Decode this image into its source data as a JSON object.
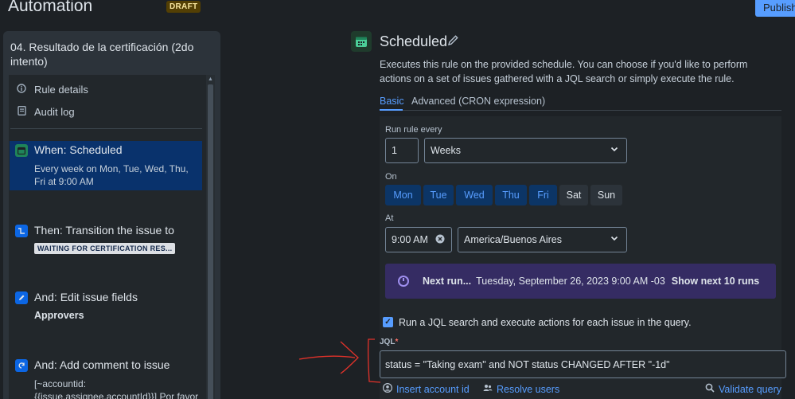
{
  "header": {
    "title": "Automation",
    "draft_badge": "DRAFT",
    "publish_label": "Publish"
  },
  "sidebar": {
    "rule_name": "04. Resultado de la certificación (2do intento)",
    "links": [
      {
        "label": "Rule details",
        "icon": "info-icon"
      },
      {
        "label": "Audit log",
        "icon": "document-icon"
      }
    ],
    "steps": [
      {
        "title": "When: Scheduled",
        "subtitle": "Every week on Mon, Tue, Wed, Thu, Fri at 9:00 AM",
        "icon": "calendar-icon",
        "active": true
      },
      {
        "title": "Then: Transition the issue to",
        "badge": "WAITING FOR CERTIFICATION RES...",
        "icon": "transition-icon"
      },
      {
        "title": "And: Edit issue fields",
        "detail": "Approvers",
        "icon": "pencil-icon"
      },
      {
        "title": "And: Add comment to issue",
        "detail_lines": [
          "[~accountid:",
          "{{issue.assignee.accountId}}] Por favor"
        ],
        "icon": "comment-icon"
      }
    ]
  },
  "main": {
    "title": "Scheduled",
    "description": "Executes this rule on the provided schedule. You can choose if you'd like to perform actions on a set of issues gathered with a JQL search or simply execute the rule.",
    "tabs": [
      "Basic",
      "Advanced (CRON expression)"
    ],
    "run_every_label": "Run rule every",
    "run_every_value": "1",
    "run_every_unit": "Weeks",
    "on_label": "On",
    "days": [
      {
        "label": "Mon",
        "selected": true
      },
      {
        "label": "Tue",
        "selected": true
      },
      {
        "label": "Wed",
        "selected": true
      },
      {
        "label": "Thu",
        "selected": true
      },
      {
        "label": "Fri",
        "selected": true
      },
      {
        "label": "Sat",
        "selected": false
      },
      {
        "label": "Sun",
        "selected": false
      }
    ],
    "at_label": "At",
    "time_value": "9:00 AM",
    "timezone_value": "America/Buenos Aires",
    "next_run_label": "Next run...",
    "next_run_value": "Tuesday, September 26, 2023 9:00 AM -03",
    "show_next_label": "Show next 10 runs",
    "jql_checkbox_label": "Run a JQL search and execute actions for each issue in the query.",
    "jql_checkbox_checked": true,
    "jql_label": "JQL",
    "jql_required_mark": "*",
    "jql_value": "status = \"Taking exam\" and NOT status CHANGED AFTER \"-1d\"",
    "insert_account_label": "Insert account id",
    "resolve_users_label": "Resolve users",
    "validate_query_label": "Validate query"
  },
  "colors": {
    "accent": "#579dff",
    "annotation": "#e2322a",
    "next_run_bg": "#352c63"
  }
}
